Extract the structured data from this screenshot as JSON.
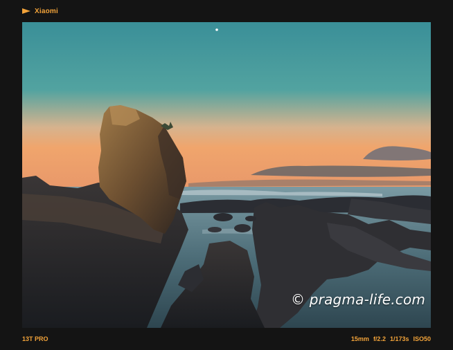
{
  "header": {
    "brand": "Xiaomi",
    "brand_icon": "pennant-flag-icon",
    "accent_color": "#f2a33a"
  },
  "photo": {
    "watermark": "© pragma-life.com"
  },
  "footer": {
    "model": "13T PRO",
    "exif": {
      "focal_length": "15mm",
      "aperture": "f/2.2",
      "shutter": "1/173s",
      "iso": "ISO50"
    }
  }
}
